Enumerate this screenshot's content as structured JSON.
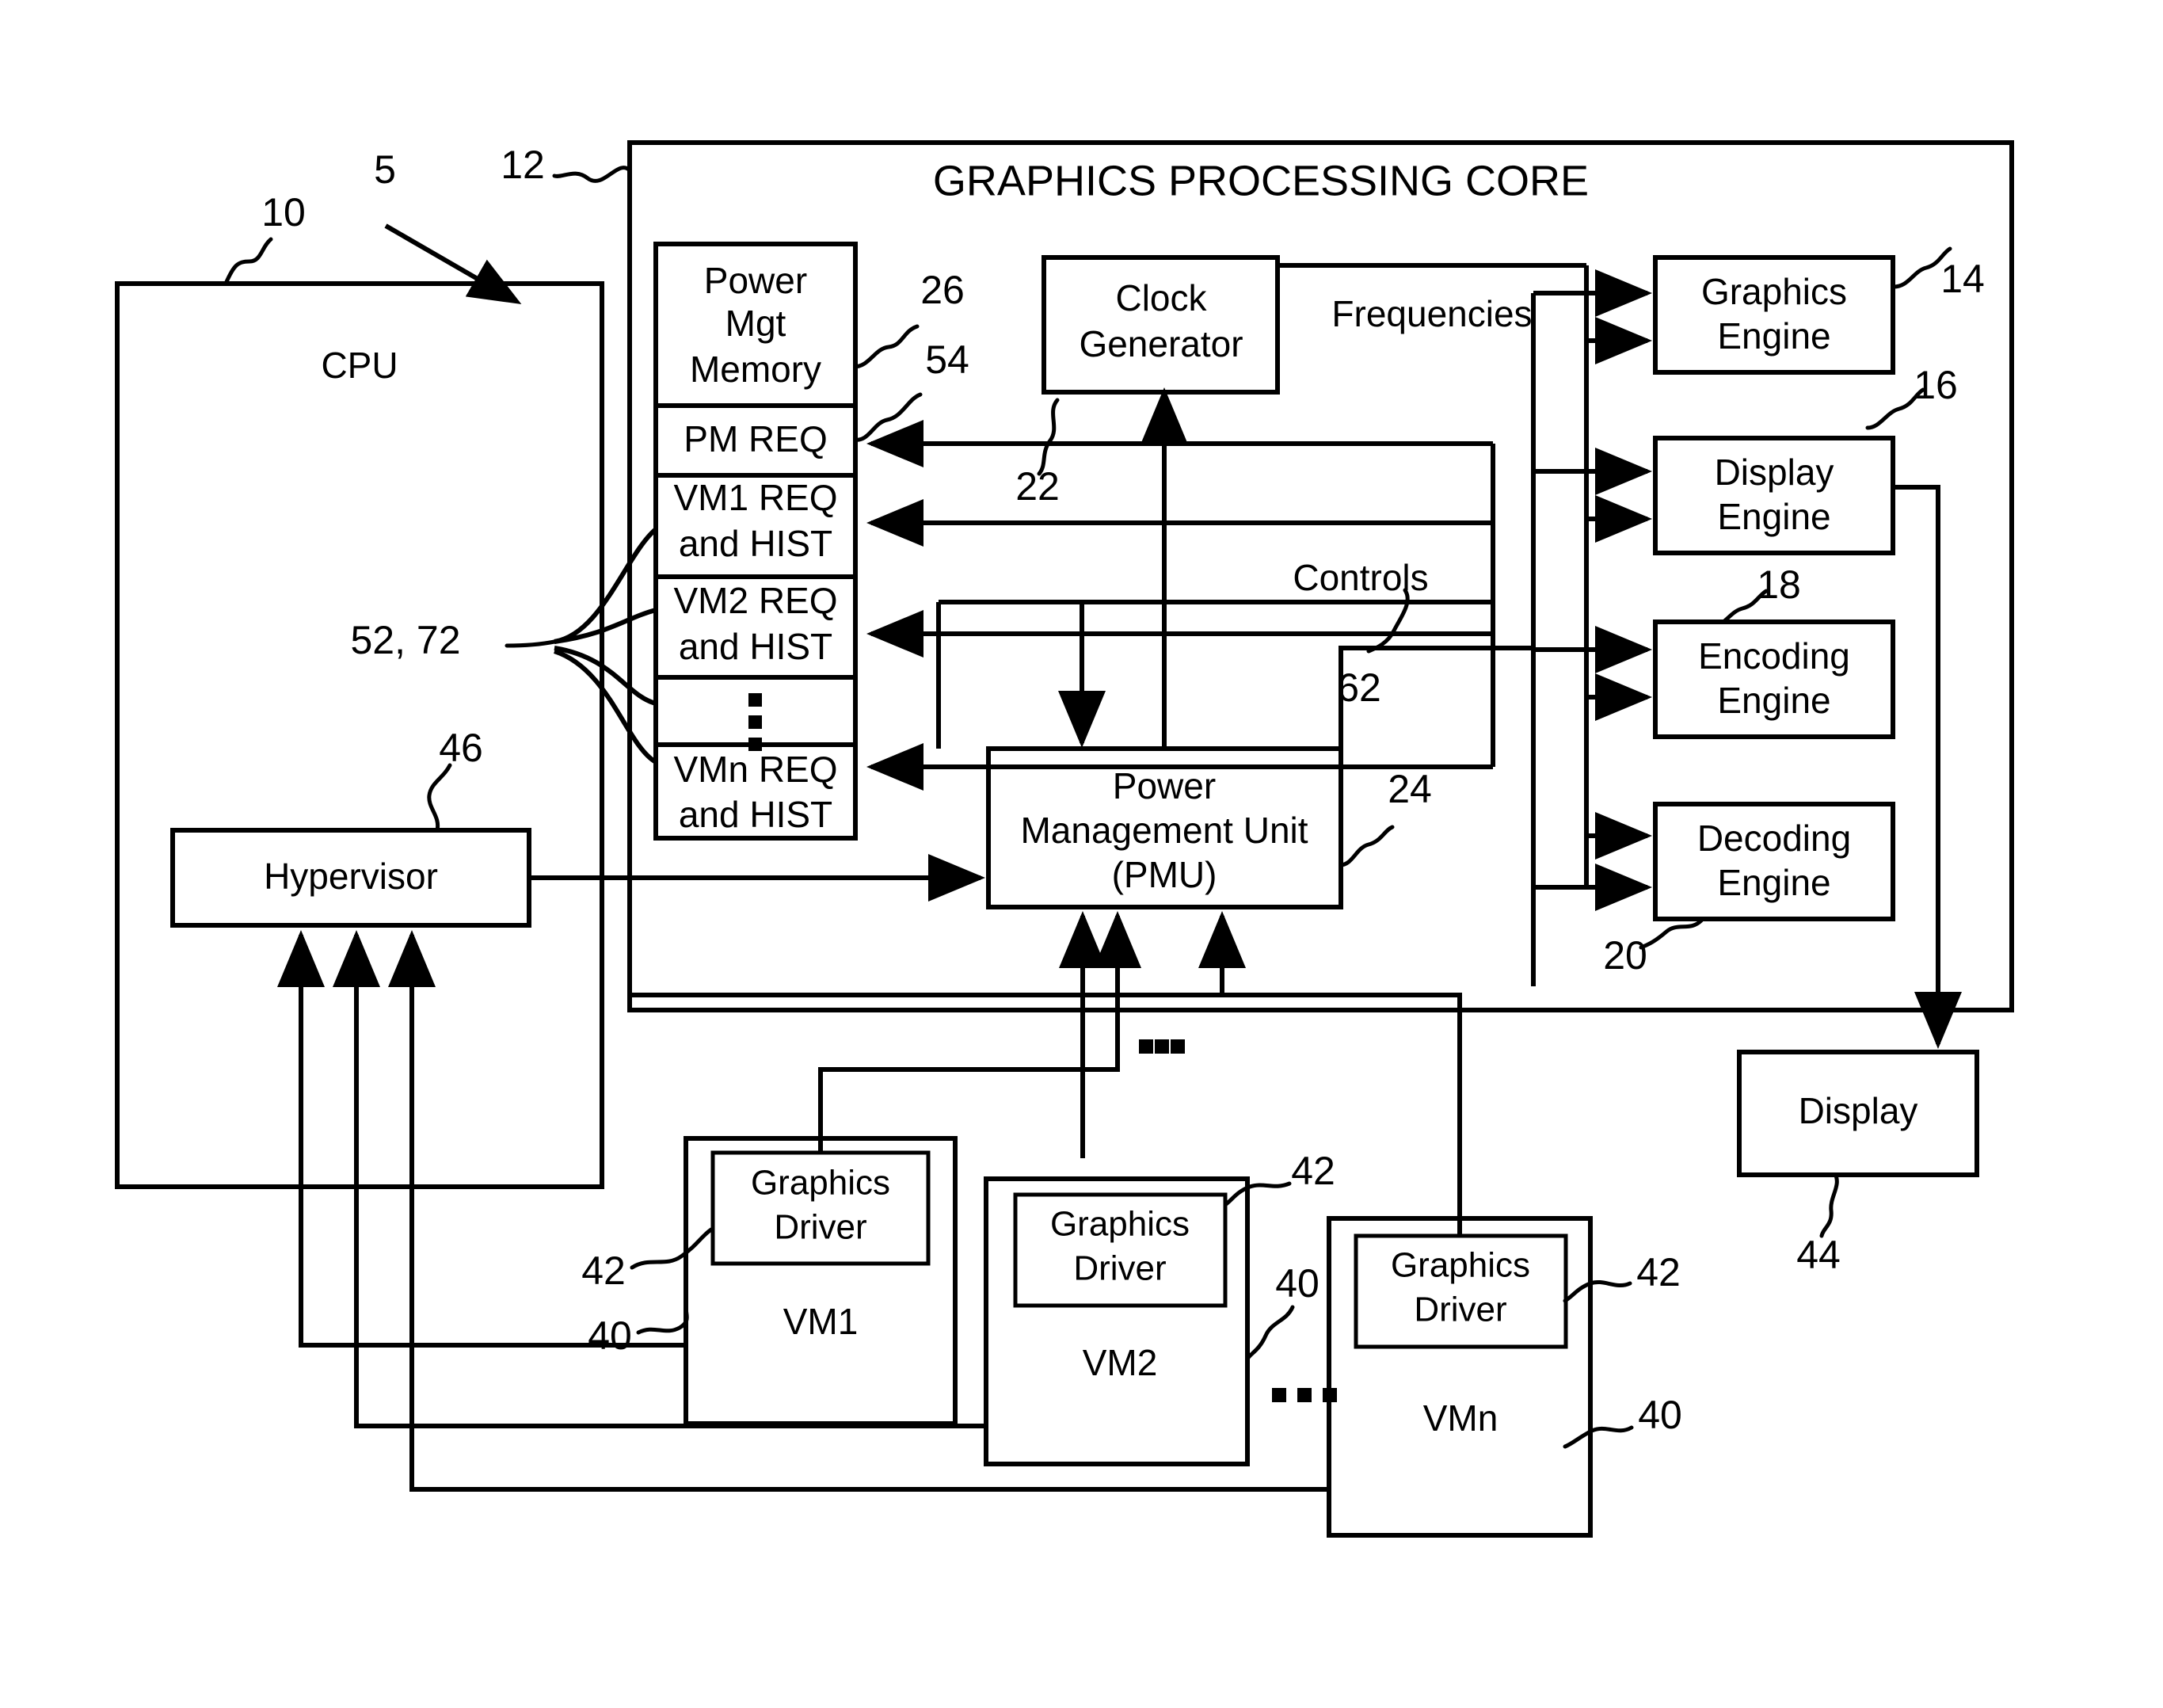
{
  "figure": {
    "title": "GRAPHICS PROCESSING CORE",
    "system_ref": "5"
  },
  "blocks": {
    "cpu": {
      "label": "CPU",
      "ref": "10"
    },
    "gpu_core": {
      "label": "GRAPHICS PROCESSING CORE",
      "ref": "12"
    },
    "power_mgt_memory": {
      "label_line1": "Power",
      "label_line2": "Mgt",
      "label_line3": "Memory",
      "ref": "26"
    },
    "memory_rows": [
      {
        "text": "PM REQ",
        "ref": "54"
      },
      {
        "line1": "VM1 REQ",
        "line2": "and HIST"
      },
      {
        "line1": "VM2 REQ",
        "line2": "and HIST"
      },
      {
        "text": "⋮"
      },
      {
        "line1": "VMn REQ",
        "line2": "and HIST"
      }
    ],
    "memory_fanout_ref": "52, 72",
    "clock_generator": {
      "line1": "Clock",
      "line2": "Generator",
      "ref": "22"
    },
    "pmu": {
      "line1": "Power",
      "line2": "Management Unit",
      "line3": "(PMU)",
      "ref": "24"
    },
    "hypervisor": {
      "label": "Hypervisor",
      "ref": "46"
    },
    "engines": [
      {
        "line1": "Graphics",
        "line2": "Engine",
        "ref": "14"
      },
      {
        "line1": "Display",
        "line2": "Engine",
        "ref": "16"
      },
      {
        "line1": "Encoding",
        "line2": "Engine",
        "ref": "18"
      },
      {
        "line1": "Decoding",
        "line2": "Engine",
        "ref": "20"
      }
    ],
    "display": {
      "label": "Display",
      "ref": "44"
    },
    "vms": [
      {
        "name": "VM1",
        "driver_line1": "Graphics",
        "driver_line2": "Driver",
        "driver_ref": "42",
        "vm_ref": "40"
      },
      {
        "name": "VM2",
        "driver_line1": "Graphics",
        "driver_line2": "Driver",
        "driver_ref": "42",
        "vm_ref": "40"
      },
      {
        "name": "VMn",
        "driver_line1": "Graphics",
        "driver_line2": "Driver",
        "driver_ref": "42",
        "vm_ref": "40"
      }
    ],
    "vm_ellipsis": "▪▪▪"
  },
  "signals": {
    "frequencies": "Frequencies",
    "controls": {
      "label": "Controls",
      "ref": "62"
    },
    "pmu_bus_ellipsis": "▪▪▪"
  }
}
